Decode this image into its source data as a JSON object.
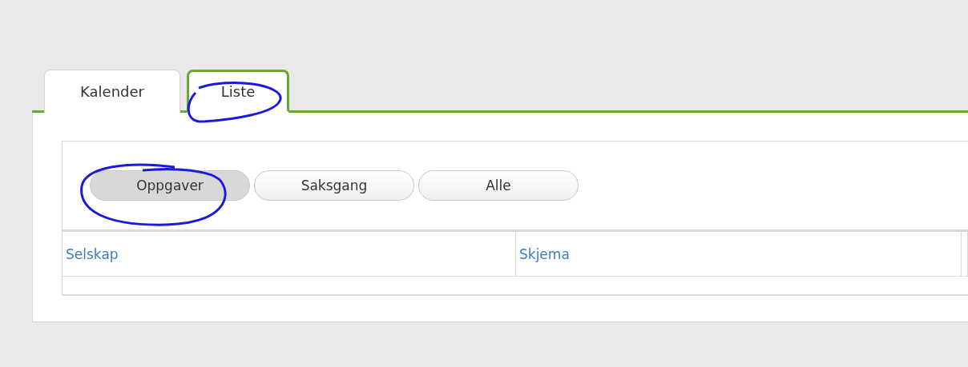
{
  "tabs": [
    {
      "label": "Kalender",
      "selected": false,
      "highlighted": false
    },
    {
      "label": "Liste",
      "selected": true,
      "highlighted": true
    }
  ],
  "filters": [
    {
      "label": "Oppgaver",
      "selected": true,
      "highlighted": true
    },
    {
      "label": "Saksgang",
      "selected": false,
      "highlighted": false
    },
    {
      "label": "Alle",
      "selected": false,
      "highlighted": false
    }
  ],
  "table": {
    "columns": [
      "Selskap",
      "Skjema"
    ]
  }
}
